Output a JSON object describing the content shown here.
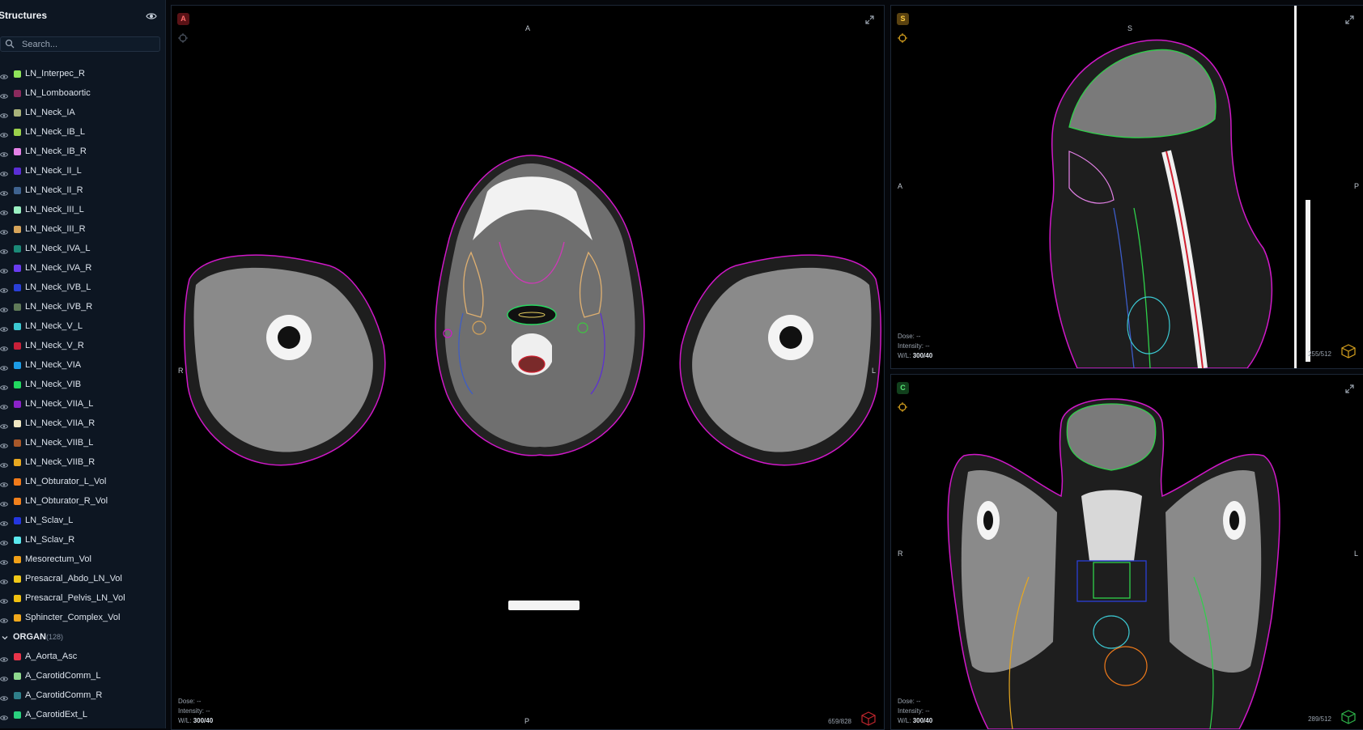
{
  "sidebar": {
    "title": "Structures",
    "search_placeholder": "Search...",
    "items": [
      {
        "label": "LN_Interpec_R",
        "color": "#8fe35a"
      },
      {
        "label": "LN_Lomboaortic",
        "color": "#8a2a5c"
      },
      {
        "label": "LN_Neck_IA",
        "color": "#a9b27a"
      },
      {
        "label": "LN_Neck_IB_L",
        "color": "#9bd14b"
      },
      {
        "label": "LN_Neck_IB_R",
        "color": "#e582e8"
      },
      {
        "label": "LN_Neck_II_L",
        "color": "#5b2ed6"
      },
      {
        "label": "LN_Neck_II_R",
        "color": "#3f6390"
      },
      {
        "label": "LN_Neck_III_L",
        "color": "#9af0c2"
      },
      {
        "label": "LN_Neck_III_R",
        "color": "#d6a45a"
      },
      {
        "label": "LN_Neck_IVA_L",
        "color": "#1b8a78"
      },
      {
        "label": "LN_Neck_IVA_R",
        "color": "#6a3cf0"
      },
      {
        "label": "LN_Neck_IVB_L",
        "color": "#2a3fd8"
      },
      {
        "label": "LN_Neck_IVB_R",
        "color": "#5f7a58"
      },
      {
        "label": "LN_Neck_V_L",
        "color": "#3cc8d2"
      },
      {
        "label": "LN_Neck_V_R",
        "color": "#c82038"
      },
      {
        "label": "LN_Neck_VIA",
        "color": "#1c9ce6"
      },
      {
        "label": "LN_Neck_VIB",
        "color": "#22d860"
      },
      {
        "label": "LN_Neck_VIIA_L",
        "color": "#8a22c8"
      },
      {
        "label": "LN_Neck_VIIA_R",
        "color": "#efe6c2"
      },
      {
        "label": "LN_Neck_VIIB_L",
        "color": "#a8582a"
      },
      {
        "label": "LN_Neck_VIIB_R",
        "color": "#e8a820"
      },
      {
        "label": "LN_Obturator_L_Vol",
        "color": "#f07a1a"
      },
      {
        "label": "LN_Obturator_R_Vol",
        "color": "#f0801c"
      },
      {
        "label": "LN_Sclav_L",
        "color": "#2436e0"
      },
      {
        "label": "LN_Sclav_R",
        "color": "#5ae8ee"
      },
      {
        "label": "Mesorectum_Vol",
        "color": "#f0a018"
      },
      {
        "label": "Presacral_Abdo_LN_Vol",
        "color": "#f0c818"
      },
      {
        "label": "Presacral_Pelvis_LN_Vol",
        "color": "#f0c010"
      },
      {
        "label": "Sphincter_Complex_Vol",
        "color": "#f0a81c"
      }
    ],
    "group": {
      "name": "ORGAN",
      "count": "(128)"
    },
    "organ_items": [
      {
        "label": "A_Aorta_Asc",
        "color": "#e8344a"
      },
      {
        "label": "A_CarotidComm_L",
        "color": "#8ed88e"
      },
      {
        "label": "A_CarotidComm_R",
        "color": "#2f7f8a"
      },
      {
        "label": "A_CarotidExt_L",
        "color": "#2ad07e"
      }
    ]
  },
  "viewports": {
    "axial": {
      "badge": "A",
      "badge_color": "#c0262d",
      "top": "A",
      "bottom": "P",
      "left": "R",
      "right": "L",
      "dose_label": "Dose:",
      "dose": "--",
      "intensity_label": "Intensity:",
      "intensity": "--",
      "wl_label": "W/L:",
      "wl": "300/40",
      "slice": "659/828",
      "cube_color": "#c0262d"
    },
    "sagittal": {
      "badge": "S",
      "badge_color": "#d8a21e",
      "top": "S",
      "left": "A",
      "right": "P",
      "dose_label": "Dose:",
      "dose": "--",
      "intensity_label": "Intensity:",
      "intensity": "--",
      "wl_label": "W/L:",
      "wl": "300/40",
      "slice": "255/512",
      "cube_color": "#d8a21e"
    },
    "coronal": {
      "badge": "C",
      "badge_color": "#2fb44a",
      "left": "R",
      "right": "L",
      "dose_label": "Dose:",
      "dose": "--",
      "intensity_label": "Intensity:",
      "intensity": "--",
      "wl_label": "W/L:",
      "wl": "300/40",
      "slice": "289/512",
      "cube_color": "#2fb44a"
    }
  }
}
